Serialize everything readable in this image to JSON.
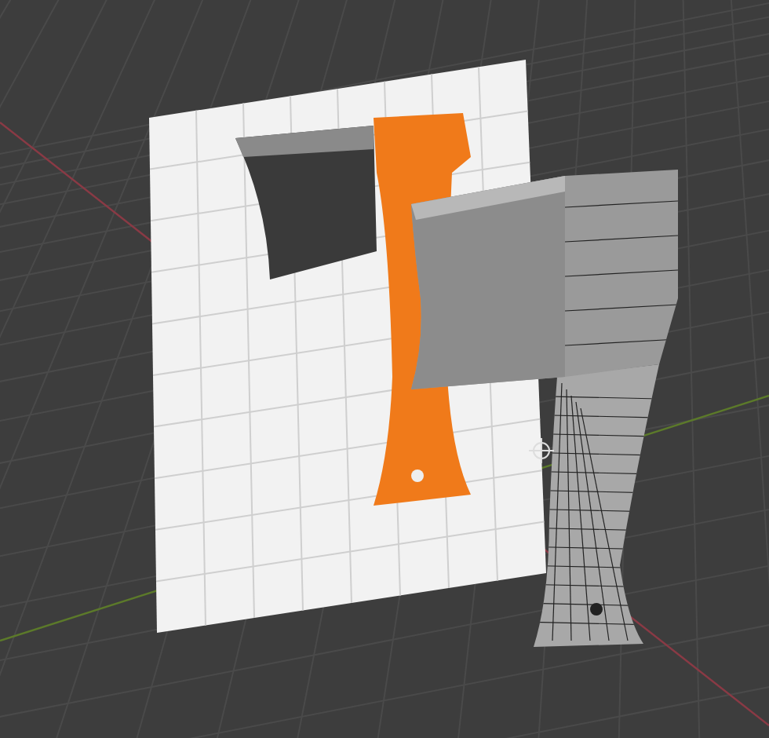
{
  "viewport": {
    "show_grid": true,
    "show_axes": true,
    "show_wireframe": true
  }
}
